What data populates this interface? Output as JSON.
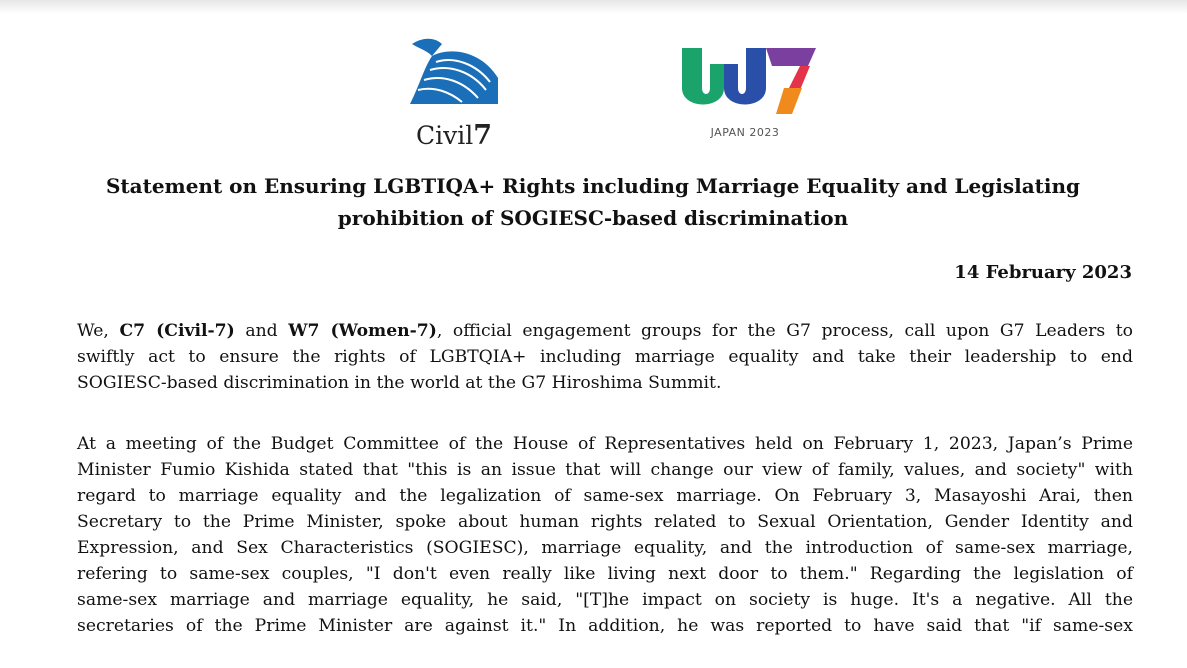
{
  "logos": {
    "civil7": {
      "name": "Civil",
      "number": "7"
    },
    "w7": {
      "subtitle": "JAPAN 2023"
    }
  },
  "document": {
    "title_line1": "Statement on Ensuring LGBTIQA+ Rights including Marriage Equality and Legislating",
    "title_line2": "prohibition of SOGIESC-based discrimination",
    "date": "14 February 2023",
    "paragraph1": {
      "lead": "We, ",
      "c7": "C7 (Civil-7)",
      "and": " and ",
      "w7": "W7 (Women-7)",
      "rest_line1": ", official engagement groups for the G7 process, call upon G7 Leaders to",
      "line2": "swiftly act to ensure the rights of LGBTQIA+ including marriage equality and take their leadership to end",
      "line3": "SOGIESC-based discrimination  in the world at the G7 Hiroshima Summit."
    },
    "paragraph2": {
      "lines": [
        "At a meeting of the Budget Committee of the House of Representatives held on February 1, 2023, Japan’s Prime",
        "Minister Fumio Kishida stated that \"this is an issue that will change our view of family, values, and society\" with",
        "regard to marriage equality and the legalization of same-sex marriage. On February 3, Masayoshi Arai, then",
        "Secretary to the Prime Minister, spoke about human rights related to Sexual Orientation, Gender Identity and",
        "Expression, and Sex Characteristics (SOGIESC), marriage equality, and the introduction of same-sex marriage,",
        "refering to   same-sex couples, \"I don't even really like living next door to them.\" Regarding the legislation of",
        "same-sex marriage and marriage equality, he said, \"[T]he impact on society is huge. It's a negative. All the",
        "secretaries of the Prime Minister are against it.\" In addition, he was reported to have said that \"if same-sex"
      ]
    }
  },
  "colors": {
    "c7_blue": "#1a6fb8",
    "w7_green": "#1aa36b",
    "w7_blue": "#2a4fa8",
    "w7_purple": "#7b3fa0",
    "w7_red": "#e2334a",
    "w7_orange": "#f08a1c"
  }
}
